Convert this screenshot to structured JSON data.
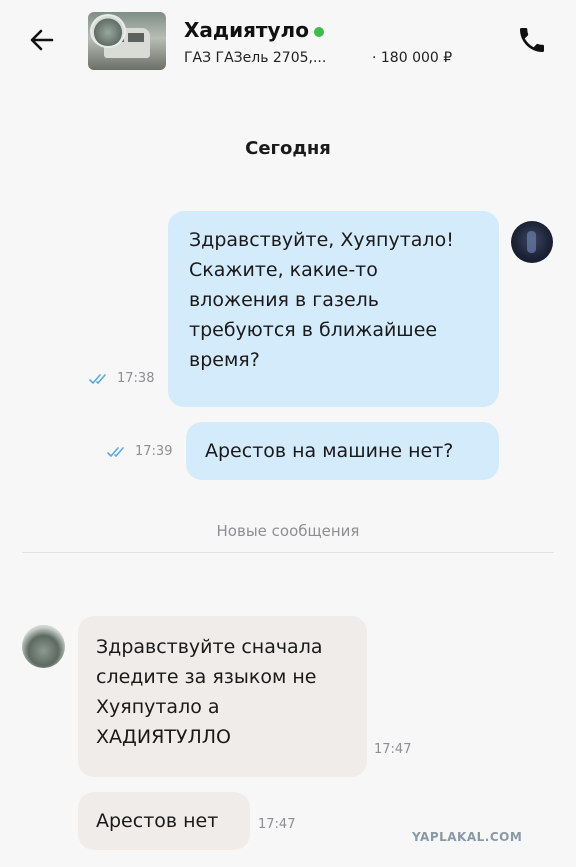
{
  "header": {
    "back_icon": "arrow-left-icon",
    "contact_name": "Хадиятуло",
    "online_color": "#3dbb4c",
    "listing_title": "ГАЗ ГАЗель 2705,...",
    "listing_price": "· 180 000 ₽",
    "phone_icon": "phone-icon"
  },
  "chat": {
    "day_label": "Сегодня",
    "outgoing": [
      {
        "lines": [
          "Здравствуйте, Хуяпутало!",
          "Скажите, какие-то",
          "вложения в газель",
          "требуются в ближайшее",
          "время?"
        ],
        "time": "17:38",
        "status_icon": "double-check-icon"
      },
      {
        "lines": [
          "Арестов на машине нет?"
        ],
        "time": "17:39",
        "status_icon": "double-check-icon"
      }
    ],
    "new_messages_label": "Новые сообщения",
    "incoming": [
      {
        "lines": [
          "Здравствуйте сначала",
          "следите за языком не",
          "Хуяпутало а",
          "ХАДИЯТУЛЛО"
        ],
        "time": "17:47"
      },
      {
        "lines": [
          "Арестов нет"
        ],
        "time": "17:47"
      }
    ]
  },
  "colors": {
    "outgoing_bubble": "#d4ebfb",
    "incoming_bubble": "#efece9",
    "read_check": "#5aa9e6"
  },
  "watermark": "YAPLAKAL.COM"
}
